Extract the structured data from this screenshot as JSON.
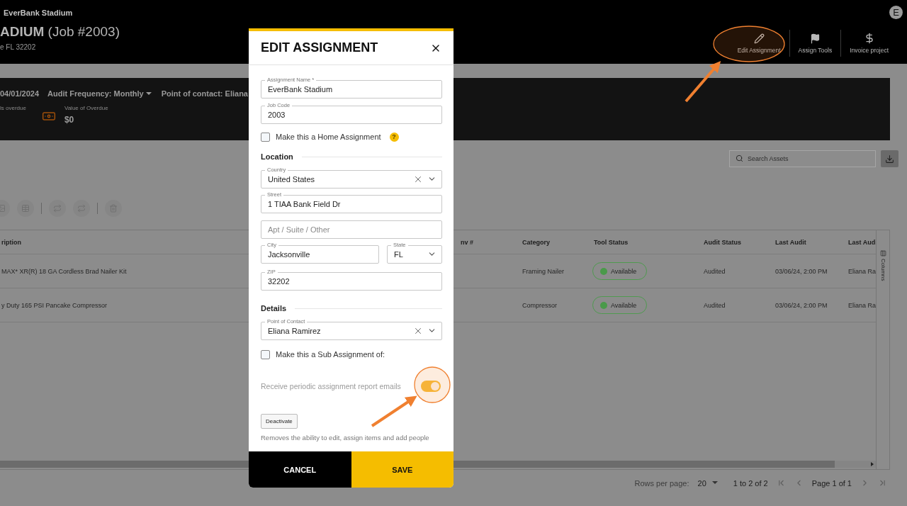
{
  "top_bar": {
    "breadcrumb": "EverBank Stadium",
    "avatar": "E"
  },
  "header": {
    "title": "ADIUM",
    "job": "(Job #2003)",
    "address": "e FL 32202",
    "actions": [
      {
        "label": "Edit Assignment"
      },
      {
        "label": "Assign Tools"
      },
      {
        "label": "Invoice project"
      }
    ]
  },
  "summary": {
    "date": "04/01/2024",
    "audit_frequency": "Audit Frequency: Monthly",
    "point_of_contact": "Point of contact: Eliana",
    "stats": [
      {
        "label": "ls overdue"
      },
      {
        "label": "Value of Overdue",
        "value": "$0"
      }
    ]
  },
  "search": {
    "placeholder": "Search Assets"
  },
  "table": {
    "columns": [
      "ription",
      "nv #",
      "Category",
      "Tool Status",
      "Audit Status",
      "Last Audit",
      "Last Audi"
    ],
    "rows": [
      {
        "description": "MAX* XR(R) 18 GA Cordless Brad Nailer Kit",
        "category": "Framing Nailer",
        "tool_status": "Available",
        "audit_status": "Audited",
        "last_audit": "03/06/24, 2:00 PM",
        "last_audit_by": "Eliana Ra"
      },
      {
        "description": "y Duty 165 PSI Pancake Compressor",
        "category": "Compressor",
        "tool_status": "Available",
        "audit_status": "Audited",
        "last_audit": "03/06/24, 2:00 PM",
        "last_audit_by": "Eliana Ra"
      }
    ],
    "side_panel": "Columns"
  },
  "pagination": {
    "rows_per_page_label": "Rows per page:",
    "rows_per_page": "20",
    "range": "1 to 2 of 2",
    "page": "Page 1 of 1"
  },
  "dialog": {
    "title": "EDIT ASSIGNMENT",
    "assignment_name": {
      "label": "Assignment Name *",
      "value": "EverBank Stadium"
    },
    "job_code": {
      "label": "Job Code",
      "value": "2003"
    },
    "home_assignment": {
      "label": "Make this a Home Assignment",
      "checked": false,
      "help": "?"
    },
    "location_heading": "Location",
    "country": {
      "label": "Country",
      "value": "United States"
    },
    "street": {
      "label": "Street",
      "value": "1 TIAA Bank Field Dr"
    },
    "apt": {
      "placeholder": "Apt / Suite / Other"
    },
    "city": {
      "label": "City",
      "value": "Jacksonville"
    },
    "state": {
      "label": "State",
      "value": "FL"
    },
    "zip": {
      "label": "ZIP",
      "value": "32202"
    },
    "details_heading": "Details",
    "point_of_contact": {
      "label": "Point of Contact",
      "value": "Eliana Ramirez"
    },
    "sub_assignment": {
      "label": "Make this a Sub Assignment of:",
      "checked": false
    },
    "report_emails": {
      "label": "Receive periodic assignment report emails",
      "on": true
    },
    "deactivate": {
      "label": "Deactivate",
      "note": "Removes the ability to edit, assign items and add people"
    },
    "cancel": "CANCEL",
    "save": "SAVE"
  }
}
